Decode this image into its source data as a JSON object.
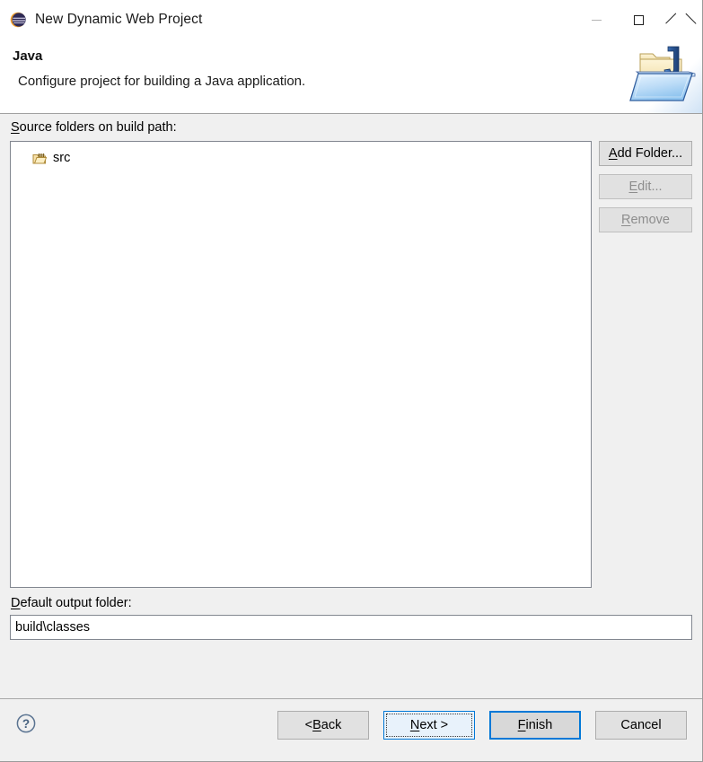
{
  "window": {
    "title": "New Dynamic Web Project",
    "icon": "eclipse-logo-icon",
    "controls": {
      "minimize": "minimize-icon",
      "maximize": "maximize-icon",
      "close": "close-icon"
    }
  },
  "header": {
    "title": "Java",
    "description": "Configure project for building a Java application.",
    "banner_icon": "java-folder-banner-icon"
  },
  "main": {
    "source_folders": {
      "label_prefix": "S",
      "label_rest": "ource folders on build path:",
      "items": [
        {
          "name": "src",
          "icon": "source-folder-icon"
        }
      ]
    },
    "side_buttons": [
      {
        "name": "add-folder",
        "mnemonic": "A",
        "rest": "dd Folder...",
        "enabled": true
      },
      {
        "name": "edit",
        "mnemonic": "E",
        "rest": "dit...",
        "enabled": false
      },
      {
        "name": "remove",
        "mnemonic": "R",
        "rest": "emove",
        "enabled": false
      }
    ],
    "output_folder": {
      "label_prefix": "D",
      "label_rest": "efault output folder:",
      "value": "build\\classes",
      "placeholder": ""
    }
  },
  "footer": {
    "help_icon": "help-question-icon",
    "buttons": [
      {
        "name": "back",
        "pre": "< ",
        "mnemonic": "B",
        "rest": "ack",
        "state": "normal"
      },
      {
        "name": "next",
        "pre": "",
        "mnemonic": "N",
        "rest": "ext >",
        "state": "focused"
      },
      {
        "name": "finish",
        "pre": "",
        "mnemonic": "F",
        "rest": "inish",
        "state": "default"
      },
      {
        "name": "cancel",
        "pre": "",
        "mnemonic": "",
        "rest": "Cancel",
        "state": "normal"
      }
    ]
  },
  "colors": {
    "accent": "#0078d7",
    "dialog_bg": "#f0f0f0",
    "field_bg": "#ffffff",
    "border": "#828790",
    "disabled_text": "#8d8d8d"
  }
}
